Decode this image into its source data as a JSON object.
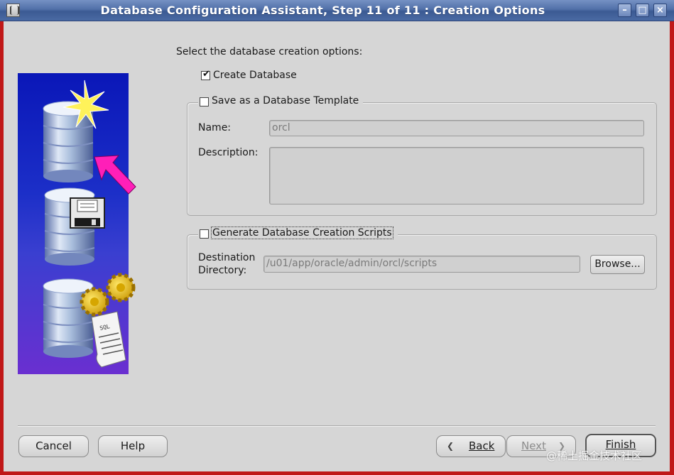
{
  "window": {
    "title": "Database Configuration Assistant, Step 11 of 11 : Creation Options",
    "controls": {
      "minimize": "–",
      "maximize": "□",
      "close": "×"
    }
  },
  "main": {
    "instruction": "Select the database creation options:",
    "create_database": {
      "label": "Create Database",
      "checked": true
    },
    "save_template": {
      "label": "Save as a Database Template",
      "checked": false,
      "name_label": "Name:",
      "name_value": "orcl",
      "description_label": "Description:",
      "description_value": ""
    },
    "generate_scripts": {
      "label": "Generate Database Creation Scripts",
      "checked": false,
      "destination_label_line1": "Destination",
      "destination_label_line2": "Directory:",
      "destination_value": "/u01/app/oracle/admin/orcl/scripts",
      "browse_label": "Browse..."
    }
  },
  "footer": {
    "cancel": "Cancel",
    "help": "Help",
    "back": "Back",
    "next": "Next",
    "finish": "Finish",
    "back_arrow": "❮",
    "next_arrow": "❯"
  },
  "watermark": "@稀土掘金技术社区",
  "image_sql_label": "SQL",
  "icons": [
    "app-icon",
    "database-star-icon",
    "arrow-icon",
    "floppy-disk-icon",
    "gear-icon",
    "sql-script-icon"
  ]
}
